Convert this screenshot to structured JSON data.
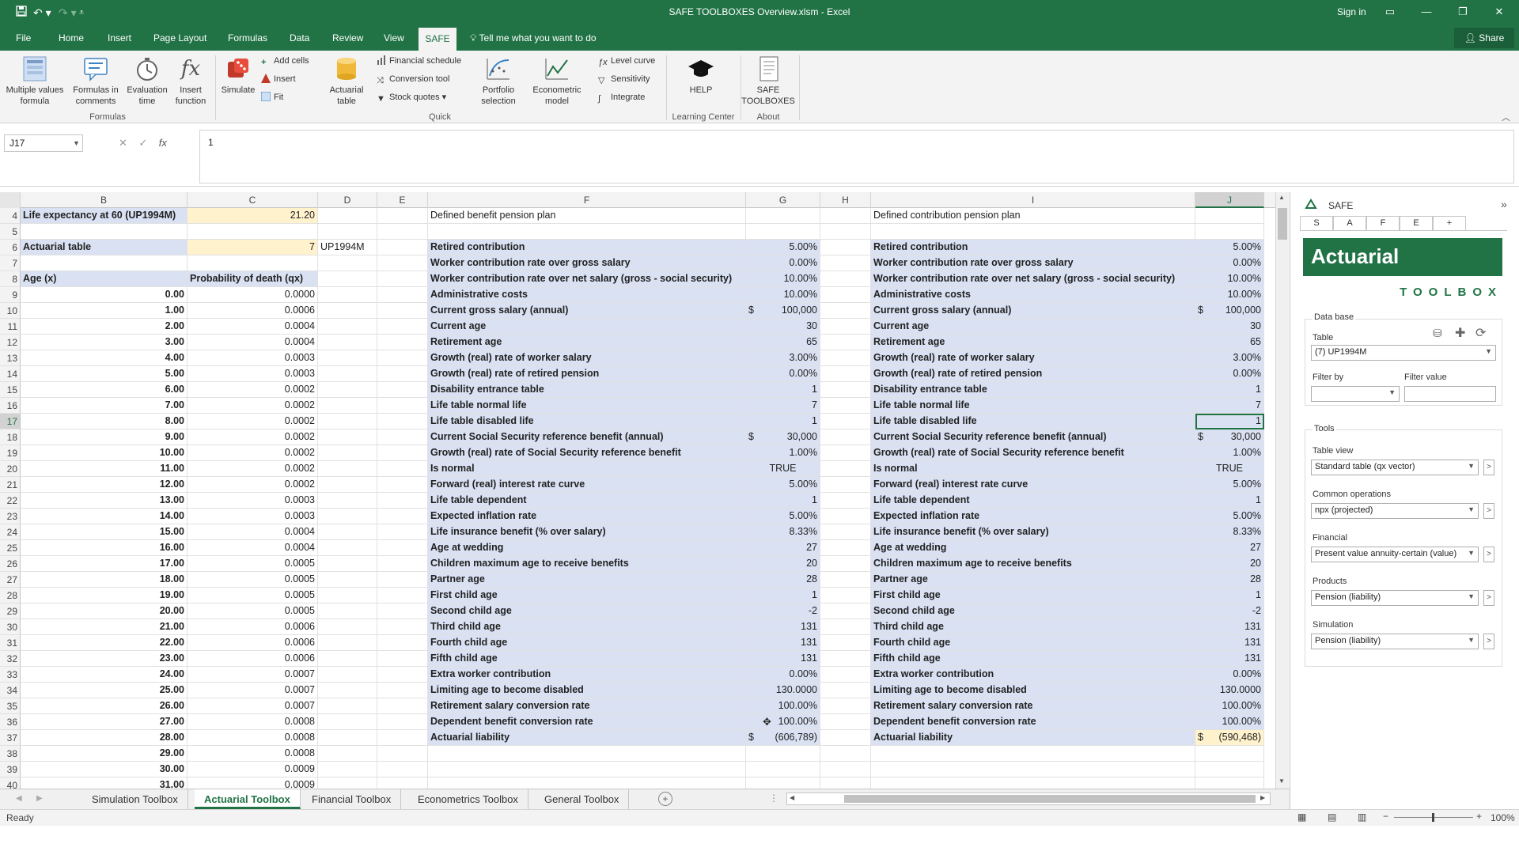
{
  "window": {
    "title": "SAFE TOOLBOXES Overview.xlsm - Excel",
    "signin": "Sign in",
    "share": "Share"
  },
  "ribbon_tabs": [
    "File",
    "Home",
    "Insert",
    "Page Layout",
    "Formulas",
    "Data",
    "Review",
    "View",
    "SAFE"
  ],
  "tell_me": "Tell me what you want to do",
  "ribbon": {
    "multiple_values_formula": "Multiple values formula",
    "formulas_in_comments": "Formulas in comments",
    "evaluation_time": "Evaluation time",
    "insert_function": "Insert function",
    "simulate": "Simulate",
    "add_cells": "Add cells",
    "insert": "Insert",
    "fit": "Fit",
    "actuarial_table": "Actuarial table",
    "financial_schedule": "Financial schedule",
    "conversion_tool": "Conversion tool",
    "stock_quotes": "Stock quotes",
    "portfolio_selection": "Portfolio selection",
    "econometric_model": "Econometric model",
    "level_curve": "Level curve",
    "sensitivity": "Sensitivity",
    "integrate": "Integrate",
    "help": "HELP",
    "safe_toolboxes": "SAFE TOOLBOXES",
    "group_formulas": "Formulas",
    "group_quick": "Quick",
    "group_learning": "Learning Center",
    "group_about": "About"
  },
  "formula_bar": {
    "name_box": "J17",
    "value": "1"
  },
  "columns": [
    "B",
    "C",
    "D",
    "E",
    "F",
    "G",
    "H",
    "I",
    "J"
  ],
  "header_rows": {
    "r4": {
      "b": "Life expectancy at 60 (UP1994M)",
      "c": "21.20",
      "f": "Defined benefit pension plan",
      "i": "Defined contribution pension plan"
    },
    "r6": {
      "b": "Actuarial table",
      "c": "7",
      "d": "UP1994M"
    },
    "r8": {
      "b": "Age (x)",
      "c": "Probability of death (qx)"
    }
  },
  "age_table": [
    {
      "row": "9",
      "age": "0.00",
      "qx": "0.0000"
    },
    {
      "row": "10",
      "age": "1.00",
      "qx": "0.0006"
    },
    {
      "row": "11",
      "age": "2.00",
      "qx": "0.0004"
    },
    {
      "row": "12",
      "age": "3.00",
      "qx": "0.0004"
    },
    {
      "row": "13",
      "age": "4.00",
      "qx": "0.0003"
    },
    {
      "row": "14",
      "age": "5.00",
      "qx": "0.0003"
    },
    {
      "row": "15",
      "age": "6.00",
      "qx": "0.0002"
    },
    {
      "row": "16",
      "age": "7.00",
      "qx": "0.0002"
    },
    {
      "row": "17",
      "age": "8.00",
      "qx": "0.0002"
    },
    {
      "row": "18",
      "age": "9.00",
      "qx": "0.0002"
    },
    {
      "row": "19",
      "age": "10.00",
      "qx": "0.0002"
    },
    {
      "row": "20",
      "age": "11.00",
      "qx": "0.0002"
    },
    {
      "row": "21",
      "age": "12.00",
      "qx": "0.0002"
    },
    {
      "row": "22",
      "age": "13.00",
      "qx": "0.0003"
    },
    {
      "row": "23",
      "age": "14.00",
      "qx": "0.0003"
    },
    {
      "row": "24",
      "age": "15.00",
      "qx": "0.0004"
    },
    {
      "row": "25",
      "age": "16.00",
      "qx": "0.0004"
    },
    {
      "row": "26",
      "age": "17.00",
      "qx": "0.0005"
    },
    {
      "row": "27",
      "age": "18.00",
      "qx": "0.0005"
    },
    {
      "row": "28",
      "age": "19.00",
      "qx": "0.0005"
    },
    {
      "row": "29",
      "age": "20.00",
      "qx": "0.0005"
    },
    {
      "row": "30",
      "age": "21.00",
      "qx": "0.0006"
    },
    {
      "row": "31",
      "age": "22.00",
      "qx": "0.0006"
    },
    {
      "row": "32",
      "age": "23.00",
      "qx": "0.0006"
    },
    {
      "row": "33",
      "age": "24.00",
      "qx": "0.0007"
    },
    {
      "row": "34",
      "age": "25.00",
      "qx": "0.0007"
    },
    {
      "row": "35",
      "age": "26.00",
      "qx": "0.0007"
    },
    {
      "row": "36",
      "age": "27.00",
      "qx": "0.0008"
    },
    {
      "row": "37",
      "age": "28.00",
      "qx": "0.0008"
    },
    {
      "row": "38",
      "age": "29.00",
      "qx": "0.0008"
    },
    {
      "row": "39",
      "age": "30.00",
      "qx": "0.0009"
    },
    {
      "row": "40",
      "age": "31.00",
      "qx": "0.0009"
    }
  ],
  "params": [
    {
      "label": "Retired contribution",
      "db": "5.00%",
      "dc": "5.00%"
    },
    {
      "label": "Worker contribution rate over gross salary",
      "db": "0.00%",
      "dc": "0.00%"
    },
    {
      "label": "Worker contribution rate over net salary (gross - social security)",
      "db": "10.00%",
      "dc": "10.00%"
    },
    {
      "label": "Administrative costs",
      "db": "10.00%",
      "dc": "10.00%"
    },
    {
      "label": "Current gross salary (annual)",
      "db": "100,000",
      "dc": "100,000",
      "currency": "$"
    },
    {
      "label": "Current age",
      "db": "30",
      "dc": "30"
    },
    {
      "label": "Retirement age",
      "db": "65",
      "dc": "65"
    },
    {
      "label": "Growth (real) rate of worker salary",
      "db": "3.00%",
      "dc": "3.00%"
    },
    {
      "label": "Growth (real) rate of retired pension",
      "db": "0.00%",
      "dc": "0.00%"
    },
    {
      "label": "Disability entrance table",
      "db": "1",
      "dc": "1"
    },
    {
      "label": "Life table normal life",
      "db": "7",
      "dc": "7"
    },
    {
      "label": "Life table disabled life",
      "db": "1",
      "dc": "1"
    },
    {
      "label": "Current Social Security reference benefit (annual)",
      "db": "30,000",
      "dc": "30,000",
      "currency": "$"
    },
    {
      "label": "Growth (real) rate of Social Security reference benefit",
      "db": "1.00%",
      "dc": "1.00%"
    },
    {
      "label": "Is normal",
      "db": "TRUE",
      "dc": "TRUE",
      "center": true
    },
    {
      "label": "Forward (real) interest rate curve",
      "db": "5.00%",
      "dc": "5.00%"
    },
    {
      "label": "Life table dependent",
      "db": "1",
      "dc": "1"
    },
    {
      "label": "Expected inflation rate",
      "db": "5.00%",
      "dc": "5.00%"
    },
    {
      "label": "Life insurance benefit (% over salary)",
      "db": "8.33%",
      "dc": "8.33%"
    },
    {
      "label": "Age at wedding",
      "db": "27",
      "dc": "27"
    },
    {
      "label": "Children maximum age to receive benefits",
      "db": "20",
      "dc": "20"
    },
    {
      "label": "Partner age",
      "db": "28",
      "dc": "28"
    },
    {
      "label": "First child age",
      "db": "1",
      "dc": "1"
    },
    {
      "label": "Second child age",
      "db": "-2",
      "dc": "-2"
    },
    {
      "label": "Third child age",
      "db": "131",
      "dc": "131"
    },
    {
      "label": "Fourth child age",
      "db": "131",
      "dc": "131"
    },
    {
      "label": "Fifth child age",
      "db": "131",
      "dc": "131"
    },
    {
      "label": "Extra worker contribution",
      "db": "0.00%",
      "dc": "0.00%"
    },
    {
      "label": "Limiting age to become disabled",
      "db": "130.0000",
      "dc": "130.0000"
    },
    {
      "label": "Retirement salary conversion rate",
      "db": "100.00%",
      "dc": "100.00%"
    },
    {
      "label": "Dependent benefit conversion rate",
      "db": "100.00%",
      "dc": "100.00%"
    },
    {
      "label": "Actuarial liability",
      "db": "(606,789)",
      "dc": "(590,468)",
      "currency": "$"
    }
  ],
  "sheet_tabs": [
    "Simulation Toolbox",
    "Actuarial Toolbox",
    "Financial Toolbox",
    "Econometrics Toolbox",
    "General Toolbox"
  ],
  "active_sheet": "Actuarial Toolbox",
  "status": {
    "ready": "Ready",
    "zoom": "100%"
  },
  "pane": {
    "title": "SAFE",
    "tabs": [
      "S",
      "A",
      "F",
      "E",
      "+"
    ],
    "banner_title": "Actuarial",
    "banner_sub": "TOOLBOX",
    "database_label": "Data base",
    "table_label": "Table",
    "table_value": "(7) UP1994M",
    "filter_by_label": "Filter by",
    "filter_value_label": "Filter value",
    "tools_label": "Tools",
    "table_view_label": "Table view",
    "table_view_value": "Standard table (qx vector)",
    "common_ops_label": "Common operations",
    "common_ops_value": "npx (projected)",
    "financial_label": "Financial",
    "financial_value": "Present value annuity-certain (value)",
    "products_label": "Products",
    "products_value": "Pension (liability)",
    "simulation_label": "Simulation",
    "simulation_value": "Pension (liability)"
  },
  "colors": {
    "excel_green": "#217346",
    "label_blue": "#d9e1f2",
    "input_yellow": "#fff2cc"
  }
}
